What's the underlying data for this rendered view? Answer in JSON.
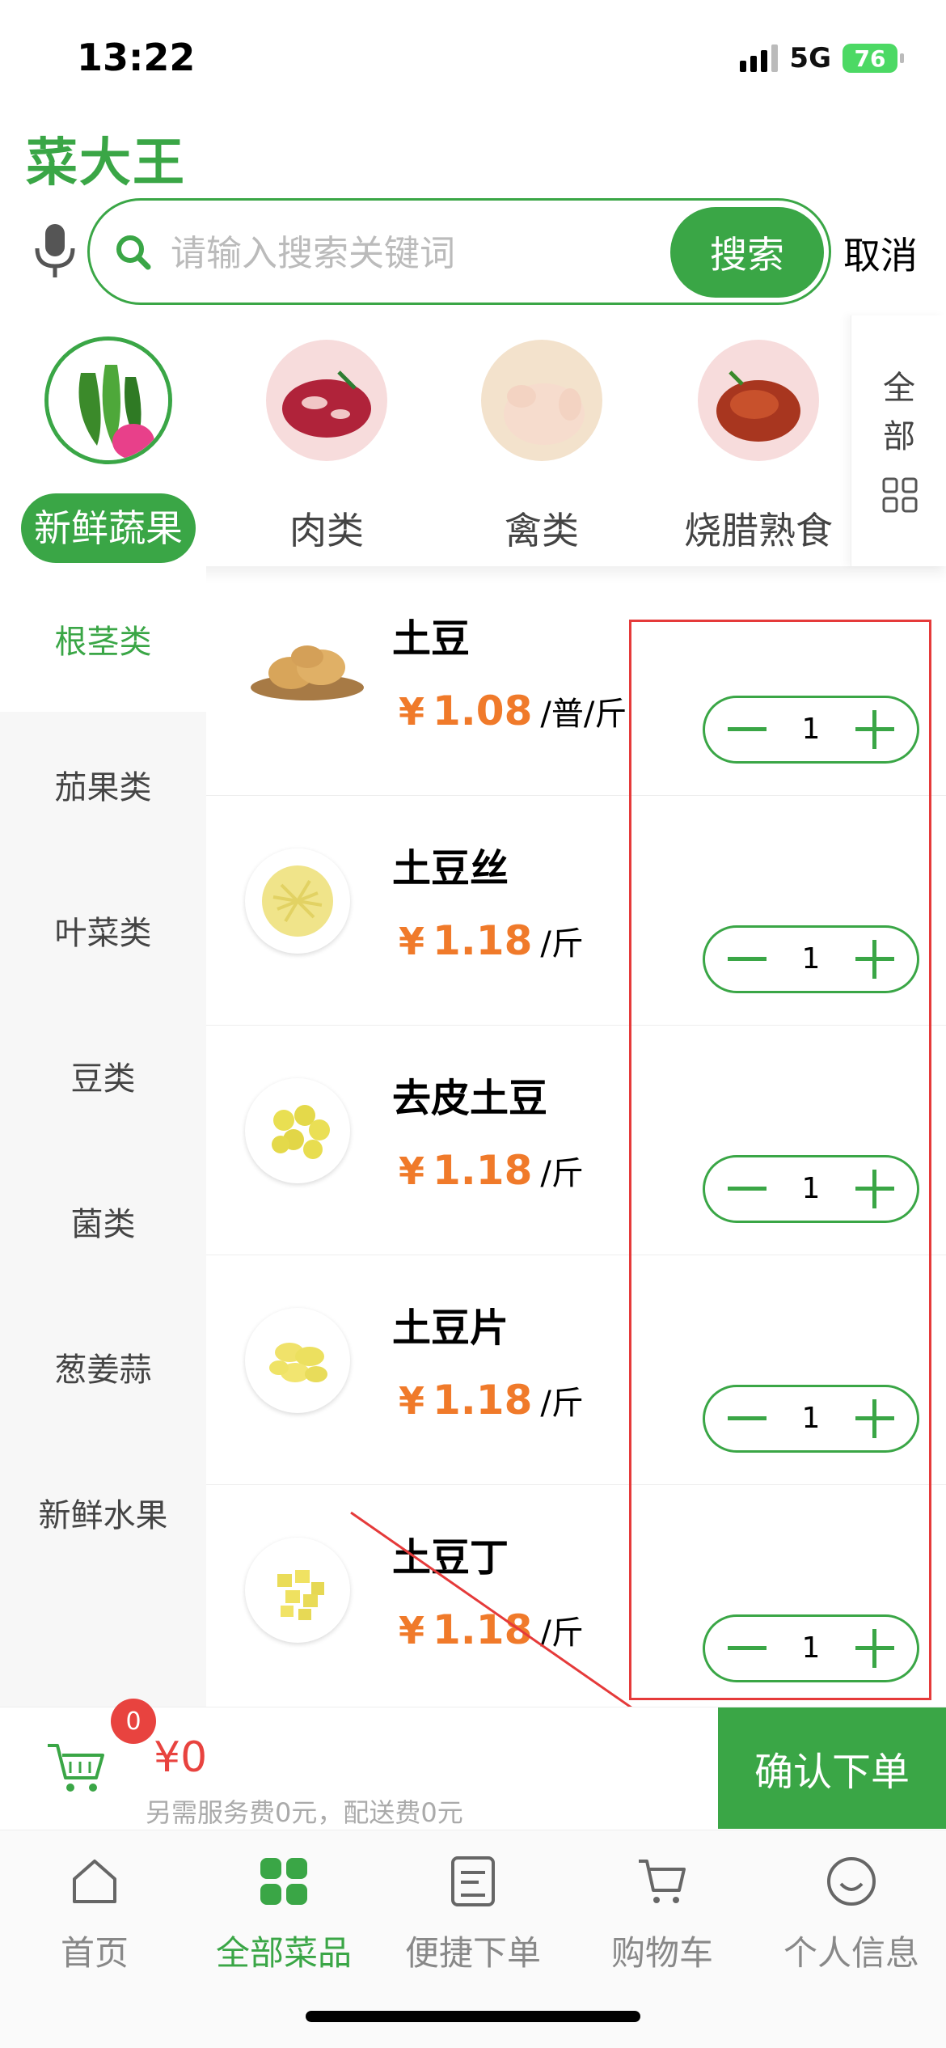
{
  "status": {
    "time": "13:22",
    "network": "5G",
    "battery": "76"
  },
  "app": {
    "title": "菜大王"
  },
  "search": {
    "placeholder": "请输入搜索关键词",
    "button": "搜索",
    "cancel": "取消"
  },
  "categories": [
    {
      "label": "新鲜蔬果",
      "active": true
    },
    {
      "label": "肉类",
      "active": false
    },
    {
      "label": "禽类",
      "active": false
    },
    {
      "label": "烧腊熟食",
      "active": false
    }
  ],
  "categories_all": "全部",
  "sidebar": {
    "items": [
      {
        "label": "根茎类",
        "active": true
      },
      {
        "label": "茄果类",
        "active": false
      },
      {
        "label": "叶菜类",
        "active": false
      },
      {
        "label": "豆类",
        "active": false
      },
      {
        "label": "菌类",
        "active": false
      },
      {
        "label": "葱姜蒜",
        "active": false
      },
      {
        "label": "新鲜水果",
        "active": false
      }
    ]
  },
  "products": [
    {
      "name": "土豆",
      "currency": "¥",
      "price": "1.08",
      "unit": "/普/斤",
      "qty": "1"
    },
    {
      "name": "土豆丝",
      "currency": "¥",
      "price": "1.18",
      "unit": "/斤",
      "qty": "1"
    },
    {
      "name": "去皮土豆",
      "currency": "¥",
      "price": "1.18",
      "unit": "/斤",
      "qty": "1"
    },
    {
      "name": "土豆片",
      "currency": "¥",
      "price": "1.18",
      "unit": "/斤",
      "qty": "1"
    },
    {
      "name": "土豆丁",
      "currency": "¥",
      "price": "1.18",
      "unit": "/斤",
      "qty": "1"
    }
  ],
  "cart": {
    "badge": "0",
    "total": "¥0",
    "note": "另需服务费0元，配送费0元",
    "confirm": "确认下单"
  },
  "tabs": [
    {
      "label": "首页",
      "icon": "home-icon",
      "active": false
    },
    {
      "label": "全部菜品",
      "icon": "grid-icon",
      "active": true
    },
    {
      "label": "便捷下单",
      "icon": "document-icon",
      "active": false
    },
    {
      "label": "购物车",
      "icon": "cart-icon",
      "active": false
    },
    {
      "label": "个人信息",
      "icon": "smile-icon",
      "active": false
    }
  ],
  "colors": {
    "accent": "#3aa646",
    "price": "#f07a2a",
    "badge": "#e8433f",
    "annotation": "#e53a3a"
  }
}
